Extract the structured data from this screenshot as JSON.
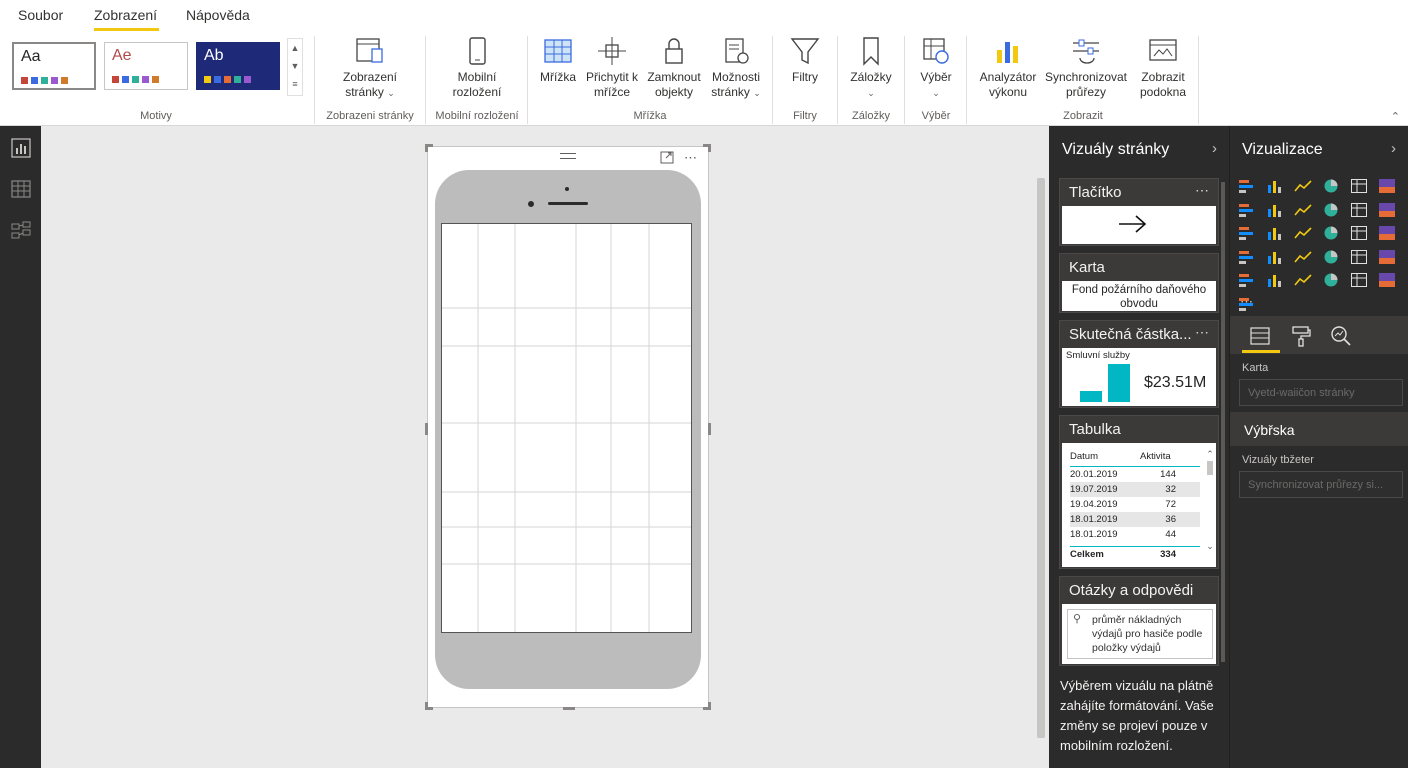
{
  "menu": {
    "file": "Soubor",
    "view": "Zobrazení",
    "help": "Nápověda"
  },
  "ribbon": {
    "themes": [
      {
        "label": "Aa",
        "text_color": "#323130",
        "bg": "#ffffff",
        "colors": [
          "#e66c37",
          "#e66c37",
          "#744ec2",
          "#118dff",
          "#c83d95",
          "#107c10"
        ]
      },
      {
        "label": "Ae",
        "text_color": "#b34a4a",
        "bg": "#ffffff",
        "colors": [
          "#c4453a",
          "#7a7a7a",
          "#2f8fb0",
          "#2fb09a",
          "#8c3a8c",
          "#d07a2b"
        ]
      },
      {
        "label": "Ab",
        "text_color": "#ffffff",
        "bg": "#1e2a78",
        "colors": [
          "#f2c811",
          "#3a6be0",
          "#e66c37",
          "#2fb09a",
          "#9b59d0",
          "#c8c6c4"
        ]
      }
    ],
    "groups": {
      "themes": "Motivy",
      "page_view": "Zobrazeni stránky",
      "mobile": "Mobilní rozložení",
      "grid": "Mřížka",
      "filters": "Filtry",
      "bookmarks": "Záložky",
      "selection": "Výběr",
      "show": "Zobrazit"
    },
    "buttons": {
      "page_view": [
        "Zobrazení",
        "stránky"
      ],
      "mobile": [
        "Mobilní",
        "rozložení"
      ],
      "gridlines": [
        "Mřížka",
        ""
      ],
      "snap": [
        "Přichytit k",
        "mřížce"
      ],
      "lock": [
        "Zamknout",
        "objekty"
      ],
      "page_options": [
        "Možnosti",
        "stránky"
      ],
      "filters": [
        "Filtry",
        ""
      ],
      "bookmarks": [
        "Záložky",
        ""
      ],
      "selection": [
        "Výběr",
        ""
      ],
      "analyzer": [
        "Analyzátor",
        "výkonu"
      ],
      "sync": [
        "Synchronizovat",
        "průřezy"
      ],
      "subwindow": [
        "Zobrazit",
        "podokna"
      ]
    }
  },
  "mobile_pane": {
    "title": "Vizuály stránky",
    "cards": {
      "button": {
        "title": "Tlačítko",
        "icon": "arrow-right-icon"
      },
      "card": {
        "title": "Karta",
        "value": "Fond požárního daňového obvodu"
      },
      "actual": {
        "title": "Skutečná částka...",
        "subtitle": "Smluvní služby",
        "value": "$23.51M",
        "bars": [
          0.3,
          1.0
        ]
      },
      "table": {
        "title": "Tabulka",
        "columns": [
          "Datum",
          "Aktivita"
        ],
        "rows": [
          [
            "20.01.2019",
            "144"
          ],
          [
            "19.07.2019",
            "32"
          ],
          [
            "19.04.2019",
            "72"
          ],
          [
            "18.01.2019",
            "36"
          ],
          [
            "18.01.2019",
            "44"
          ]
        ],
        "total_label": "Celkem",
        "total_value": "334"
      },
      "qa": {
        "title": "Otázky a odpovědi",
        "query": "průměr nákladných výdajů pro hasiče podle položky výdajů"
      }
    },
    "info": "Výběrem vizuálu na plátně zahájíte formátování. Vaše změny se projeví pouze v mobilním rozložení."
  },
  "viz_pane": {
    "title": "Vizualizace",
    "section_card": "Karta",
    "field_page": "Vyetd-waiičon stránky",
    "band_title": "Výbřska",
    "section_filter": "Vizuály tbžeter",
    "field_sync": "Synchronizovat průřezy si..."
  },
  "colors": {
    "accent": "#f2c811",
    "teal": "#00b7c3",
    "dark_pane": "#2b2b2b"
  }
}
